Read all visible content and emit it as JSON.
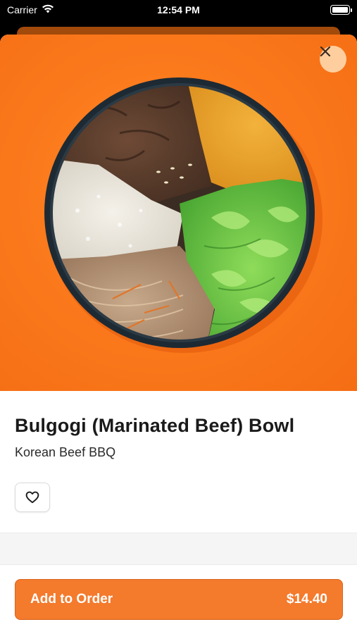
{
  "status_bar": {
    "carrier": "Carrier",
    "time": "12:54 PM"
  },
  "item": {
    "name": "Bulgogi (Marinated Beef) Bowl",
    "restaurant": "Korean Beef BBQ"
  },
  "actions": {
    "add_label": "Add to Order",
    "price": "$14.40"
  },
  "icons": {
    "close": "close-icon",
    "favorite": "heart-outline-icon",
    "wifi": "wifi-icon",
    "battery": "battery-icon"
  },
  "colors": {
    "accent": "#f47a2c",
    "hero_background": "#fb7a1c"
  }
}
